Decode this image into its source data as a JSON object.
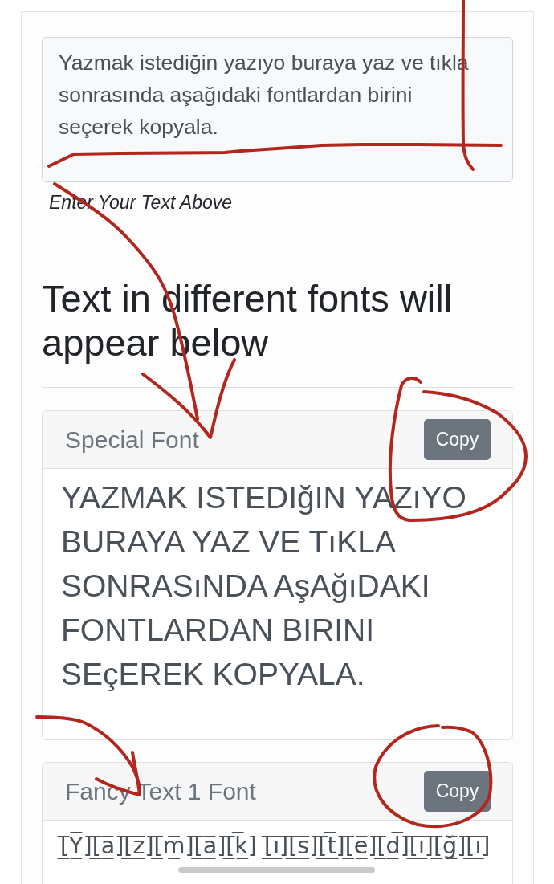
{
  "input": {
    "value": "Yazmak istediğin yazıyo buraya yaz ve tıkla sonrasında aşağıdaki fontlardan birini seçerek kopyala.",
    "help": "Enter Your Text Above"
  },
  "heading": "Text in different fonts will appear below",
  "fonts": [
    {
      "kind": "special",
      "name": "Special Font",
      "button": "Copy",
      "sample": "YAZMAK ISTEDIğIN YAZıYO BURAYA YAZ VE TıKLA SONRASıNDA AşAğıDAKI FONTLARDAN BIRINI SEçEREK KOPYALA."
    },
    {
      "kind": "fancy",
      "name": "Fancy Text 1 Font",
      "button": "Copy",
      "sample": "[̲̅Y̲̅][̲̅a̲̅][̲̅z̲̅][̲̅m̲̅][̲̅a̲̅][̲̅k̲̅] [̲̅i̲̅][̲̅s̲̅][̲̅t̲̅][̲̅e̲̅][̲̅d̲̅][̲̅i̲̅][̲̅ğ̲̅][̲̅i̲̅]"
    }
  ]
}
